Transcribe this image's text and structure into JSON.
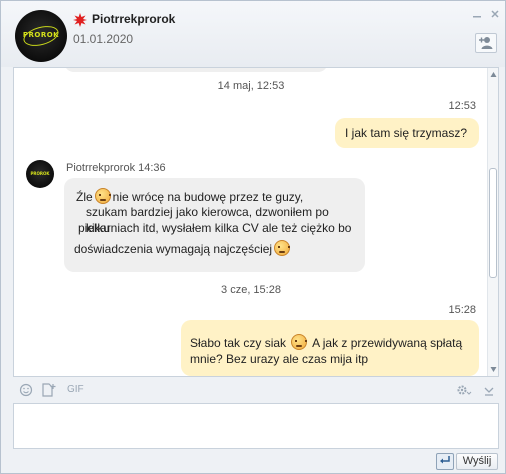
{
  "header": {
    "username": "Piotrrekprorok",
    "date": "01.01.2020",
    "avatar_logo": "PROROK",
    "status_icon": "red-star-icon",
    "add_user_icon": "add-user-icon"
  },
  "conversation": {
    "separator_1": "14 maj, 12:53",
    "msg1_time": "12:53",
    "msg1_text": "I jak tam się trzymasz?",
    "sender_line": "Piotrrekprorok 14:36",
    "msg2_part1": "Źle",
    "msg2_part2": "nie wrócę na budowę przez te guzy,",
    "msg2_part3": "szukam bardziej jako kierowca, dzwoniłem po kilku",
    "msg2_part4": "piekarniach itd, wysłałem kilka CV ale też ciężko bo",
    "msg2_part5": "doświadczenia wymagają najczęściej",
    "separator_2": "3 cze, 15:28",
    "msg3_time": "15:28",
    "msg3_part1": "Słabo tak czy siak",
    "msg3_part2": "A jak z przewidywaną spłatą",
    "msg3_part3": "mnie? Bez urazy ale czas mija itp"
  },
  "toolbar": {
    "gif_label": "GIF"
  },
  "composer": {
    "message_value": "",
    "send_label": "Wyślij"
  },
  "colors": {
    "my_bubble": "#fff2c6",
    "their_bubble": "#efefef",
    "status_red": "#e02020"
  }
}
